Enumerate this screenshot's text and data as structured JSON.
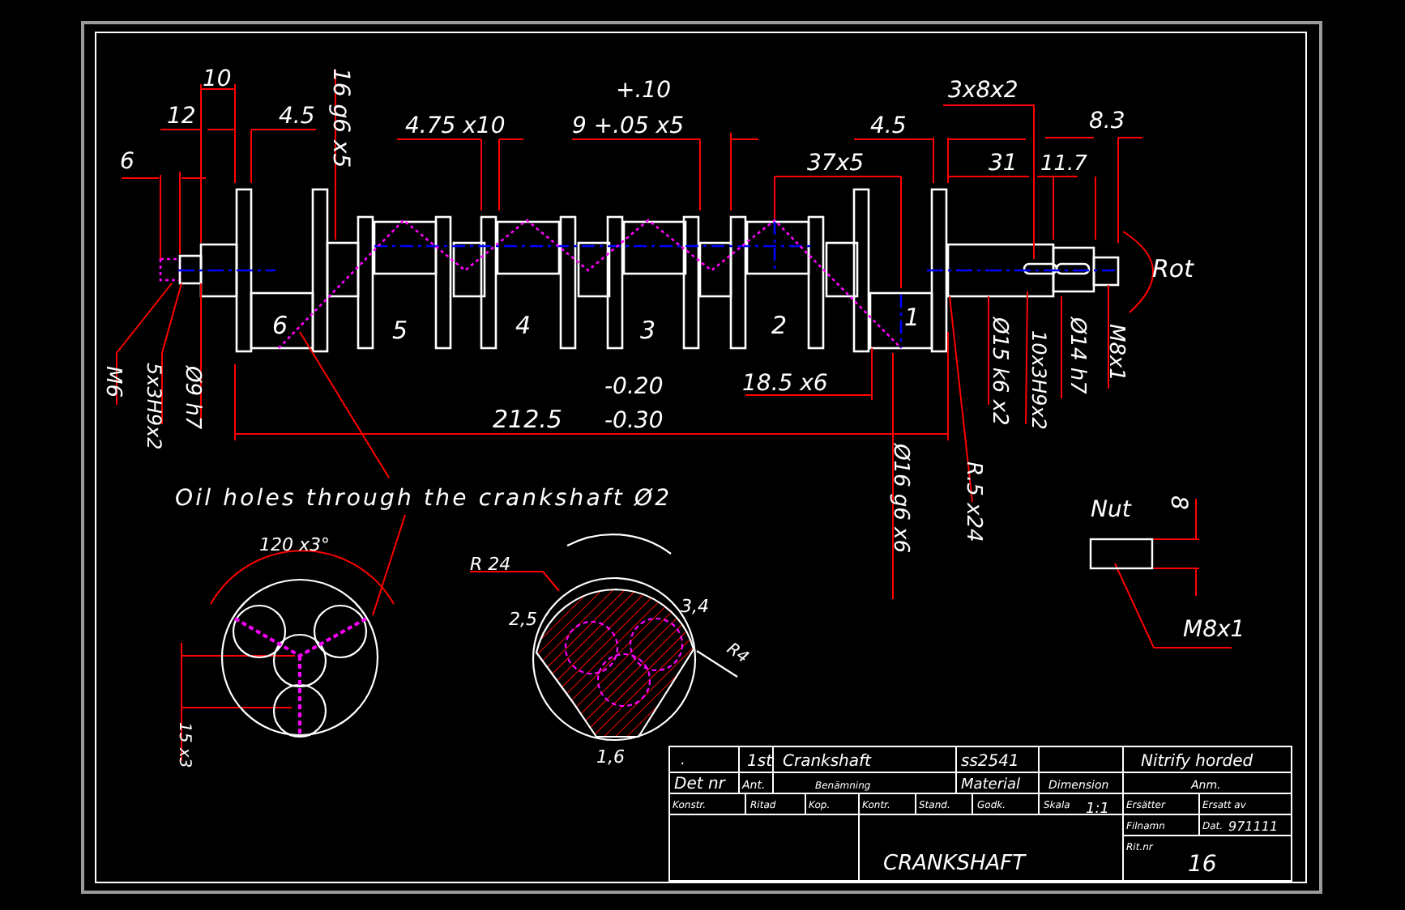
{
  "drawing": {
    "dimension_labels": [
      {
        "text": "10"
      },
      {
        "text": "12"
      },
      {
        "text": "4.5"
      },
      {
        "text": "6"
      },
      {
        "text": "4.75 x10"
      },
      {
        "text": "+.10"
      },
      {
        "text": "9 +.05 x5"
      },
      {
        "text": "3x8x2"
      },
      {
        "text": "4.5"
      },
      {
        "text": "8.3"
      },
      {
        "text": "37x5"
      },
      {
        "text": "31"
      },
      {
        "text": "11.7"
      },
      {
        "text": "Rot"
      },
      {
        "text": "-0.20"
      },
      {
        "text": "18.5 x6"
      },
      {
        "text": "212.5"
      },
      {
        "text": "-0.30"
      },
      {
        "text": "120 x3°"
      },
      {
        "text": "R 24"
      },
      {
        "text": "2,5"
      },
      {
        "text": "3,4"
      },
      {
        "text": "1,6"
      },
      {
        "text": "Nut"
      },
      {
        "text": "M8x1"
      },
      {
        "text": "16 g6 x5"
      },
      {
        "text": "M6"
      },
      {
        "text": "5x3H9x2"
      },
      {
        "text": "Ø9 h7"
      },
      {
        "text": "Ø15 k6 x2"
      },
      {
        "text": "10x3H9x2"
      },
      {
        "text": "Ø14 h7"
      },
      {
        "text": "M8x1"
      },
      {
        "text": "Ø16 g6 x6"
      },
      {
        "text": "R.5 x24"
      },
      {
        "text": "15 x3"
      },
      {
        "text": "8"
      },
      {
        "text": "R4"
      }
    ],
    "throw_numbers": [
      "6",
      "5",
      "4",
      "3",
      "2",
      "1"
    ],
    "note": "Oil holes through the crankshaft Ø2",
    "title_block": [
      ".",
      "1st",
      "Crankshaft",
      "ss2541",
      "Nitrify horded",
      "Det nr",
      "Ant.",
      "Benämning",
      "Material",
      "Dimension",
      "Anm.",
      "Konstr.",
      "Ritad",
      "Kop.",
      "Kontr.",
      "Stand.",
      "Godk.",
      "Skala",
      "1:1",
      "Ersätter",
      "Ersatt av",
      "Filnamn",
      "Dat.",
      "971111",
      "Rit.nr",
      "16",
      "CRANKSHAFT"
    ]
  }
}
